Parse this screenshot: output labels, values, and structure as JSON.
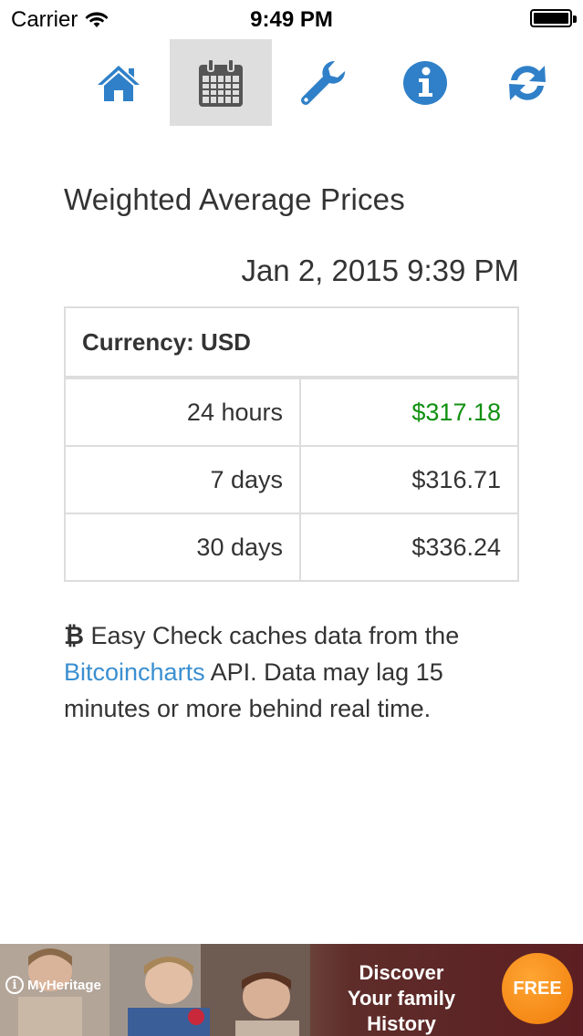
{
  "status_bar": {
    "carrier": "Carrier",
    "time": "9:49 PM"
  },
  "nav": {
    "items": [
      {
        "icon": "home-icon",
        "active": false
      },
      {
        "icon": "calendar-icon",
        "active": true
      },
      {
        "icon": "wrench-icon",
        "active": false
      },
      {
        "icon": "info-icon",
        "active": false
      },
      {
        "icon": "refresh-icon",
        "active": false
      }
    ],
    "accent_color": "#2f80c8",
    "active_icon_color": "#555555"
  },
  "page": {
    "title": "Weighted Average Prices",
    "timestamp": "Jan 2, 2015 9:39 PM"
  },
  "table": {
    "header": "Currency: USD",
    "rows": [
      {
        "period": "24 hours",
        "price": "$317.18",
        "highlight": true
      },
      {
        "period": "7 days",
        "price": "$316.71",
        "highlight": false
      },
      {
        "period": "30 days",
        "price": "$336.24",
        "highlight": false
      }
    ],
    "highlight_color": "#109010"
  },
  "footnote": {
    "symbol": "₿",
    "text_1": " Easy Check caches data from the ",
    "link_text": "Bitcoincharts",
    "text_2": " API. Data may lag 15 minutes or more behind real time.",
    "link_color": "#3a8fd0"
  },
  "ad": {
    "headline_1": "Discover",
    "headline_2": "Your family History",
    "cta": "FREE",
    "brand": "MyHeritage"
  }
}
